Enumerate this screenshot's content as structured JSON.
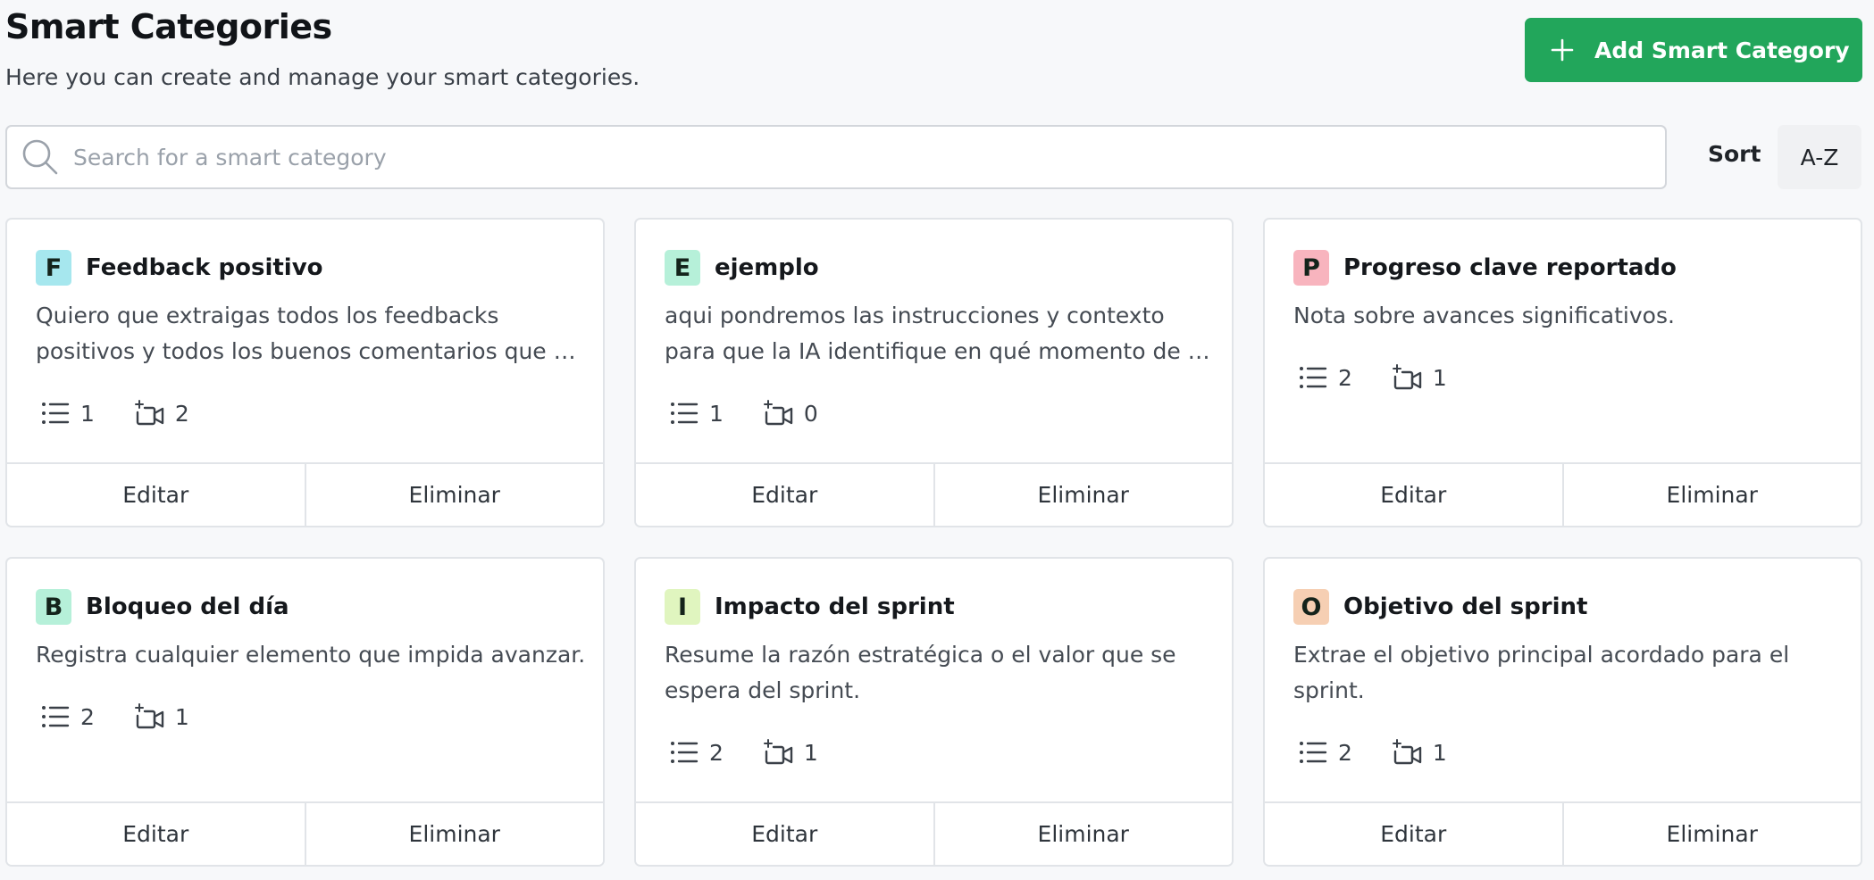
{
  "header": {
    "title": "Smart Categories",
    "subtitle": "Here you can create and manage your smart categories.",
    "add_button_label": "Add Smart Category"
  },
  "search": {
    "placeholder": "Search for a smart category",
    "value": ""
  },
  "sort": {
    "label": "Sort",
    "value": "A-Z"
  },
  "colors": {
    "primary_green": "#22a65b",
    "badge_cyan": "#a6e7ee",
    "badge_mint": "#b6f0d9",
    "badge_pink": "#f8b4be",
    "badge_lime": "#e0f5bf",
    "badge_peach": "#f6cfb3"
  },
  "icons": {
    "add": "plus-icon",
    "search": "search-icon",
    "items": "list-icon",
    "recordings": "video-sparkle-icon"
  },
  "cards": [
    {
      "initial": "F",
      "badge_color": "#a6e7ee",
      "title": "Feedback positivo",
      "description": "Quiero que extraigas todos los feedbacks positivos y todos los buenos comentarios que se han dicho durante la reunión",
      "item_count": "1",
      "recording_count": "2",
      "edit_label": "Editar",
      "delete_label": "Eliminar"
    },
    {
      "initial": "E",
      "badge_color": "#b6f0d9",
      "title": "ejemplo",
      "description": "aqui pondremos las instrucciones y contexto para que la IA identifique en qué momento de la reunión ocurre",
      "item_count": "1",
      "recording_count": "0",
      "edit_label": "Editar",
      "delete_label": "Eliminar"
    },
    {
      "initial": "P",
      "badge_color": "#f8b4be",
      "title": "Progreso clave reportado",
      "description": "Nota sobre avances significativos.",
      "item_count": "2",
      "recording_count": "1",
      "edit_label": "Editar",
      "delete_label": "Eliminar"
    },
    {
      "initial": "B",
      "badge_color": "#b6f0d9",
      "title": "Bloqueo del día",
      "description": "Registra cualquier elemento que impida avanzar.",
      "item_count": "2",
      "recording_count": "1",
      "edit_label": "Editar",
      "delete_label": "Eliminar"
    },
    {
      "initial": "I",
      "badge_color": "#e0f5bf",
      "title": "Impacto del sprint",
      "description": "Resume la razón estratégica o el valor que se espera del sprint.",
      "item_count": "2",
      "recording_count": "1",
      "edit_label": "Editar",
      "delete_label": "Eliminar"
    },
    {
      "initial": "O",
      "badge_color": "#f6cfb3",
      "title": "Objetivo del sprint",
      "description": "Extrae el objetivo principal acordado para el sprint.",
      "item_count": "2",
      "recording_count": "1",
      "edit_label": "Editar",
      "delete_label": "Eliminar"
    }
  ]
}
